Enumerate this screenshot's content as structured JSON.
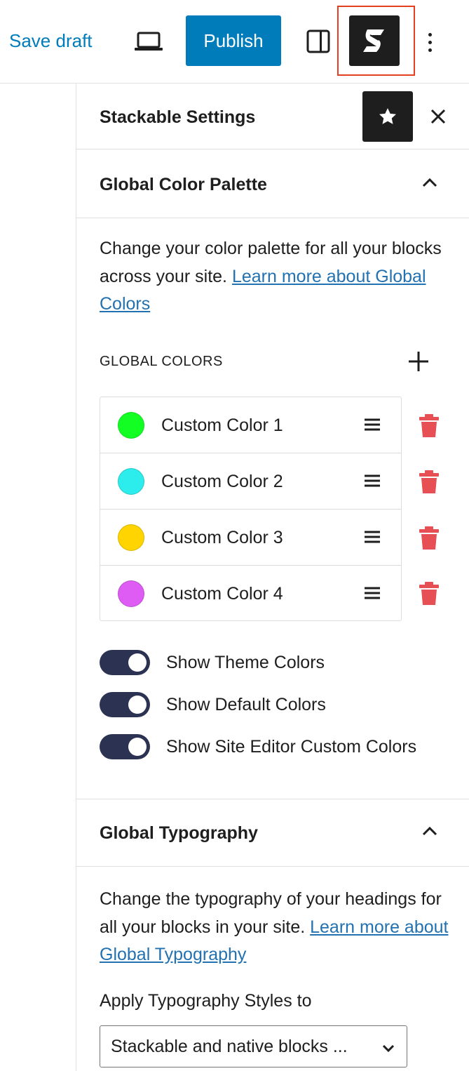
{
  "toolbar": {
    "save_draft": "Save draft",
    "publish": "Publish",
    "preview_icon": "desktop-preview-icon",
    "settings_icon": "sidebar-toggle-icon",
    "stackable_icon": "stackable-logo-icon",
    "more_icon": "more-vertical-icon",
    "accent": "#007cba",
    "highlight": "#e53f22"
  },
  "panel": {
    "title": "Stackable Settings",
    "star_icon": "star-icon",
    "close_icon": "close-icon"
  },
  "color_palette": {
    "title": "Global Color Palette",
    "desc_text": "Change your color palette for all your blocks across your site. ",
    "desc_link": "Learn more about Global Colors",
    "global_colors_label": "Global Colors",
    "colors": [
      {
        "name": "Custom Color 1",
        "color": "#13ff24"
      },
      {
        "name": "Custom Color 2",
        "color": "#2cecec"
      },
      {
        "name": "Custom Color 3",
        "color": "#ffd400"
      },
      {
        "name": "Custom Color 4",
        "color": "#de5cf4"
      }
    ],
    "toggles": [
      {
        "label": "Show Theme Colors",
        "on": true
      },
      {
        "label": "Show Default Colors",
        "on": true
      },
      {
        "label": "Show Site Editor Custom Colors",
        "on": true
      }
    ],
    "trash_color": "#e65054",
    "toggle_color": "#2b3252"
  },
  "typography": {
    "title": "Global Typography",
    "desc_text": "Change the typography of your headings for all your blocks in your site. ",
    "desc_link": "Learn more about Global Typography",
    "apply_label": "Apply Typography Styles to",
    "apply_value": "Stackable and native blocks ..."
  }
}
